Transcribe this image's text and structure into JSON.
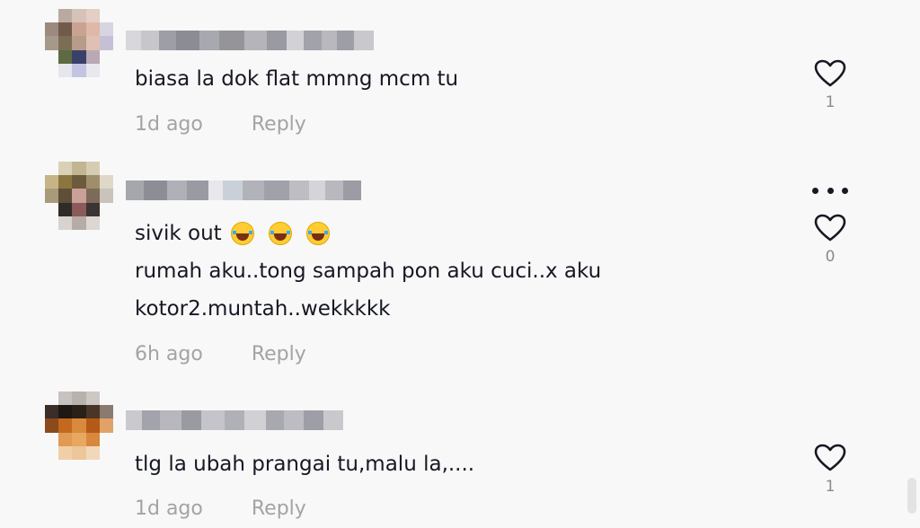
{
  "comments": [
    {
      "text_lines": [
        "biasa la dok flat mmng mcm tu"
      ],
      "time": "1d ago",
      "reply_label": "Reply",
      "like_count": "1"
    },
    {
      "text_lines": [
        "sivik out",
        "rumah aku..tong sampah pon aku cuci..x aku",
        "kotor2.muntah..wekkkkk"
      ],
      "emoji_count": 3,
      "time": "6h ago",
      "reply_label": "Reply",
      "like_count": "0"
    },
    {
      "text_lines": [
        "tlg la ubah prangai tu,malu la,...."
      ],
      "time": "1d ago",
      "reply_label": "Reply",
      "like_count": "1"
    }
  ],
  "icons": {
    "like": "heart-outline-icon",
    "more": "more-options-icon"
  },
  "colors": {
    "background": "#f8f8f8",
    "text": "#161823",
    "meta": "#a3a3a8",
    "count": "#8a8b91"
  }
}
